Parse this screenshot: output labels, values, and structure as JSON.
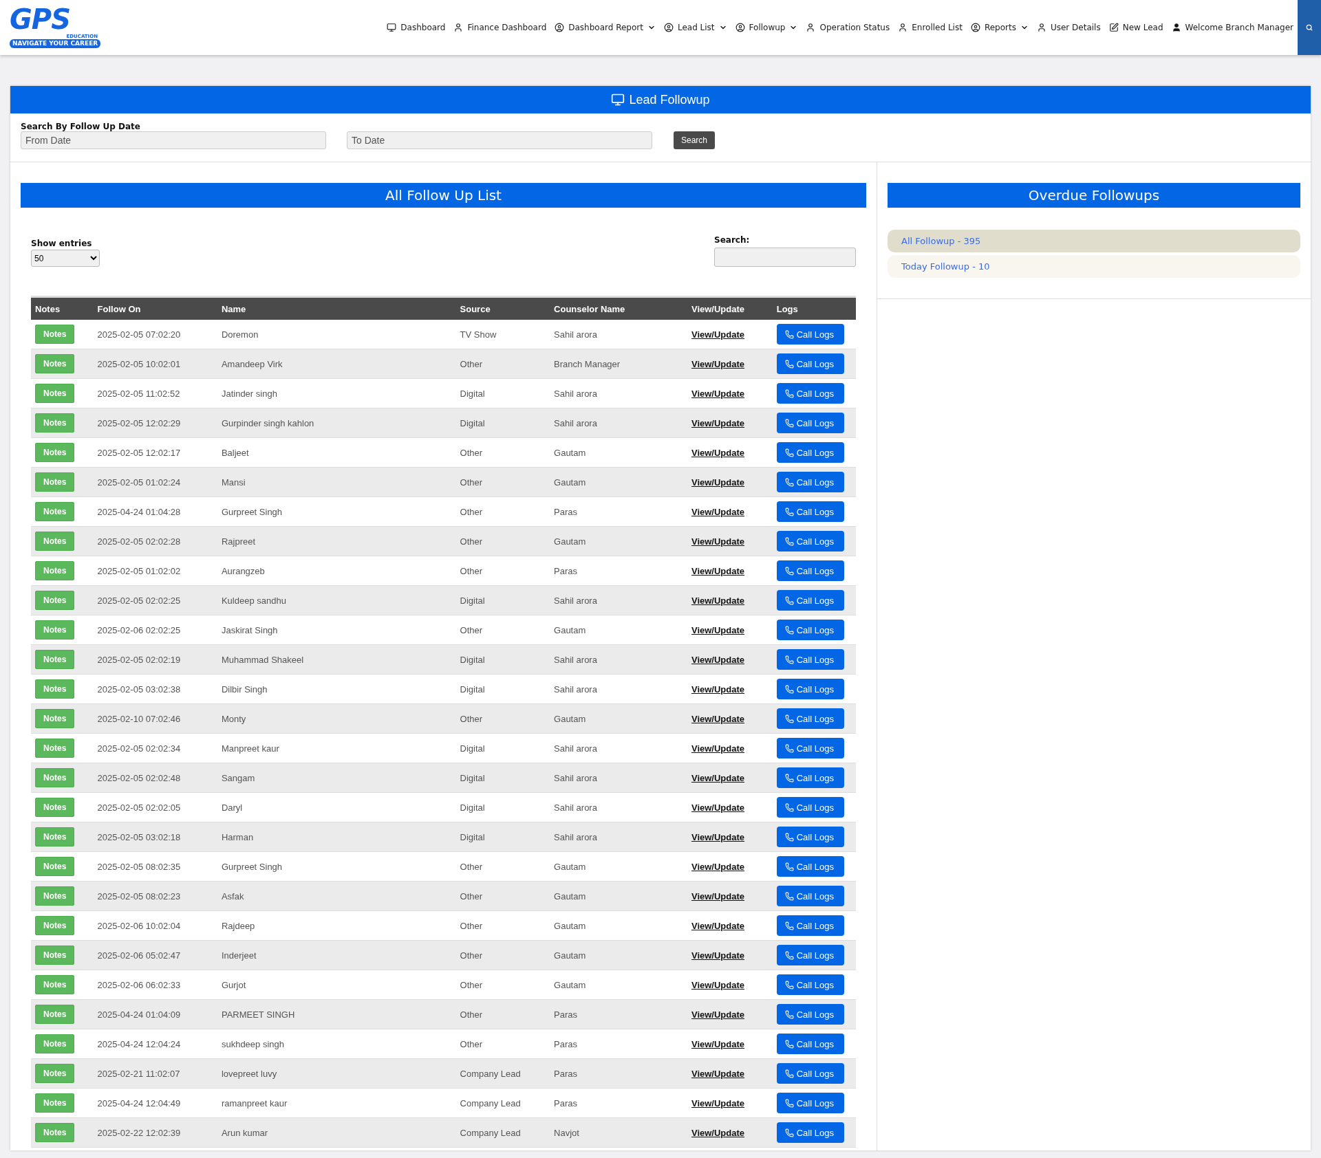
{
  "logo": {
    "mark": "GPS",
    "subtitle": "EDUCATION",
    "tagline": "NAVIGATE YOUR CAREER"
  },
  "nav": [
    {
      "label": "Dashboard",
      "kind": "monitor",
      "dropdown": false
    },
    {
      "label": "Finance Dashboard",
      "kind": "user",
      "dropdown": false
    },
    {
      "label": "Dashboard Report",
      "kind": "profile",
      "dropdown": true
    },
    {
      "label": "Lead List",
      "kind": "profile",
      "dropdown": true
    },
    {
      "label": "Followup",
      "kind": "profile",
      "dropdown": true
    },
    {
      "label": "Operation Status",
      "kind": "user",
      "dropdown": false
    },
    {
      "label": "Enrolled List",
      "kind": "user",
      "dropdown": false
    },
    {
      "label": "Reports",
      "kind": "profile",
      "dropdown": true
    },
    {
      "label": "User Details",
      "kind": "user",
      "dropdown": false
    },
    {
      "label": "New Lead",
      "kind": "edit",
      "dropdown": false
    },
    {
      "label": "Welcome Branch Manager",
      "kind": "account",
      "dropdown": false
    }
  ],
  "page_title": "Lead Followup",
  "date_search": {
    "label": "Search By Follow Up Date",
    "from": {
      "placeholder": "From Date"
    },
    "to": {
      "placeholder": "To Date"
    },
    "button": "Search"
  },
  "list": {
    "title": "All Follow Up List",
    "show_entries_label": "Show entries",
    "entries_value": "50",
    "search_label": "Search:",
    "columns": [
      "Notes",
      "Follow On",
      "Name",
      "Source",
      "Counselor Name",
      "View/Update",
      "Logs"
    ],
    "rows": [
      {
        "notes": "Notes",
        "follow_on": "2025-02-05 07:02:20",
        "name": "Doremon",
        "source": "TV Show",
        "counselor": "Sahil arora",
        "view": "View/Update",
        "logs": "Call Logs"
      },
      {
        "notes": "Notes",
        "follow_on": "2025-02-05 10:02:01",
        "name": "Amandeep Virk",
        "source": "Other",
        "counselor": "Branch Manager",
        "view": "View/Update",
        "logs": "Call Logs"
      },
      {
        "notes": "Notes",
        "follow_on": "2025-02-05 11:02:52",
        "name": "Jatinder singh",
        "source": "Digital",
        "counselor": "Sahil arora",
        "view": "View/Update",
        "logs": "Call Logs"
      },
      {
        "notes": "Notes",
        "follow_on": "2025-02-05 12:02:29",
        "name": "Gurpinder singh kahlon",
        "source": "Digital",
        "counselor": "Sahil arora",
        "view": "View/Update",
        "logs": "Call Logs"
      },
      {
        "notes": "Notes",
        "follow_on": "2025-02-05 12:02:17",
        "name": "Baljeet",
        "source": "Other",
        "counselor": "Gautam",
        "view": "View/Update",
        "logs": "Call Logs"
      },
      {
        "notes": "Notes",
        "follow_on": "2025-02-05 01:02:24",
        "name": "Mansi",
        "source": "Other",
        "counselor": "Gautam",
        "view": "View/Update",
        "logs": "Call Logs"
      },
      {
        "notes": "Notes",
        "follow_on": "2025-04-24 01:04:28",
        "name": "Gurpreet Singh",
        "source": "Other",
        "counselor": "Paras",
        "view": "View/Update",
        "logs": "Call Logs"
      },
      {
        "notes": "Notes",
        "follow_on": "2025-02-05 02:02:28",
        "name": "Rajpreet",
        "source": "Other",
        "counselor": "Gautam",
        "view": "View/Update",
        "logs": "Call Logs"
      },
      {
        "notes": "Notes",
        "follow_on": "2025-02-05 01:02:02",
        "name": "Aurangzeb",
        "source": "Other",
        "counselor": "Paras",
        "view": "View/Update",
        "logs": "Call Logs"
      },
      {
        "notes": "Notes",
        "follow_on": "2025-02-05 02:02:25",
        "name": "Kuldeep sandhu",
        "source": "Digital",
        "counselor": "Sahil arora",
        "view": "View/Update",
        "logs": "Call Logs"
      },
      {
        "notes": "Notes",
        "follow_on": "2025-02-06 02:02:25",
        "name": "Jaskirat Singh",
        "source": "Other",
        "counselor": "Gautam",
        "view": "View/Update",
        "logs": "Call Logs"
      },
      {
        "notes": "Notes",
        "follow_on": "2025-02-05 02:02:19",
        "name": "Muhammad Shakeel",
        "source": "Digital",
        "counselor": "Sahil arora",
        "view": "View/Update",
        "logs": "Call Logs"
      },
      {
        "notes": "Notes",
        "follow_on": "2025-02-05 03:02:38",
        "name": "Dilbir Singh",
        "source": "Digital",
        "counselor": "Sahil arora",
        "view": "View/Update",
        "logs": "Call Logs"
      },
      {
        "notes": "Notes",
        "follow_on": "2025-02-10 07:02:46",
        "name": "Monty",
        "source": "Other",
        "counselor": "Gautam",
        "view": "View/Update",
        "logs": "Call Logs"
      },
      {
        "notes": "Notes",
        "follow_on": "2025-02-05 02:02:34",
        "name": "Manpreet kaur",
        "source": "Digital",
        "counselor": "Sahil arora",
        "view": "View/Update",
        "logs": "Call Logs"
      },
      {
        "notes": "Notes",
        "follow_on": "2025-02-05 02:02:48",
        "name": "Sangam",
        "source": "Digital",
        "counselor": "Sahil arora",
        "view": "View/Update",
        "logs": "Call Logs"
      },
      {
        "notes": "Notes",
        "follow_on": "2025-02-05 02:02:05",
        "name": "Daryl",
        "source": "Digital",
        "counselor": "Sahil arora",
        "view": "View/Update",
        "logs": "Call Logs"
      },
      {
        "notes": "Notes",
        "follow_on": "2025-02-05 03:02:18",
        "name": "Harman",
        "source": "Digital",
        "counselor": "Sahil arora",
        "view": "View/Update",
        "logs": "Call Logs"
      },
      {
        "notes": "Notes",
        "follow_on": "2025-02-05 08:02:35",
        "name": "Gurpreet Singh",
        "source": "Other",
        "counselor": "Gautam",
        "view": "View/Update",
        "logs": "Call Logs"
      },
      {
        "notes": "Notes",
        "follow_on": "2025-02-05 08:02:23",
        "name": "Asfak",
        "source": "Other",
        "counselor": "Gautam",
        "view": "View/Update",
        "logs": "Call Logs"
      },
      {
        "notes": "Notes",
        "follow_on": "2025-02-06 10:02:04",
        "name": "Rajdeep",
        "source": "Other",
        "counselor": "Gautam",
        "view": "View/Update",
        "logs": "Call Logs"
      },
      {
        "notes": "Notes",
        "follow_on": "2025-02-06 05:02:47",
        "name": "Inderjeet",
        "source": "Other",
        "counselor": "Gautam",
        "view": "View/Update",
        "logs": "Call Logs"
      },
      {
        "notes": "Notes",
        "follow_on": "2025-02-06 06:02:33",
        "name": "Gurjot",
        "source": "Other",
        "counselor": "Gautam",
        "view": "View/Update",
        "logs": "Call Logs"
      },
      {
        "notes": "Notes",
        "follow_on": "2025-04-24 01:04:09",
        "name": "PARMEET SINGH",
        "source": "Other",
        "counselor": "Paras",
        "view": "View/Update",
        "logs": "Call Logs"
      },
      {
        "notes": "Notes",
        "follow_on": "2025-04-24 12:04:24",
        "name": "sukhdeep singh",
        "source": "Other",
        "counselor": "Paras",
        "view": "View/Update",
        "logs": "Call Logs"
      },
      {
        "notes": "Notes",
        "follow_on": "2025-02-21 11:02:07",
        "name": "lovepreet luvy",
        "source": "Company Lead",
        "counselor": "Paras",
        "view": "View/Update",
        "logs": "Call Logs"
      },
      {
        "notes": "Notes",
        "follow_on": "2025-04-24 12:04:49",
        "name": "ramanpreet kaur",
        "source": "Company Lead",
        "counselor": "Paras",
        "view": "View/Update",
        "logs": "Call Logs"
      },
      {
        "notes": "Notes",
        "follow_on": "2025-02-22 12:02:39",
        "name": "Arun kumar",
        "source": "Company Lead",
        "counselor": "Navjot",
        "view": "View/Update",
        "logs": "Call Logs"
      }
    ]
  },
  "overdue": {
    "title": "Overdue Followups",
    "items": [
      {
        "label": "All Followup - 395",
        "selected": true
      },
      {
        "label": "Today Followup - 10",
        "selected": false
      }
    ]
  }
}
